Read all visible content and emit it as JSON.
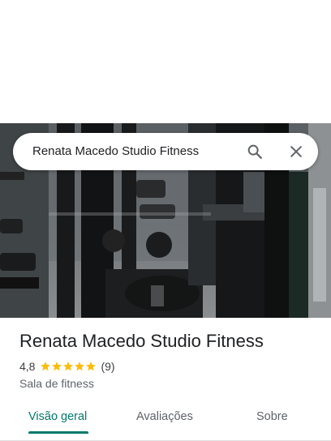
{
  "search": {
    "query": "Renata Macedo Studio Fitness",
    "search_icon": "search-icon",
    "close_icon": "close-icon"
  },
  "place": {
    "title": "Renata Macedo Studio Fitness",
    "rating": "4,8",
    "stars": 5,
    "review_count": "(9)",
    "category": "Sala de fitness"
  },
  "tabs": [
    {
      "label": "Visão geral",
      "active": true
    },
    {
      "label": "Avaliações",
      "active": false
    },
    {
      "label": "Sobre",
      "active": false
    }
  ],
  "colors": {
    "accent": "#00796b",
    "star": "#fbbc04"
  }
}
